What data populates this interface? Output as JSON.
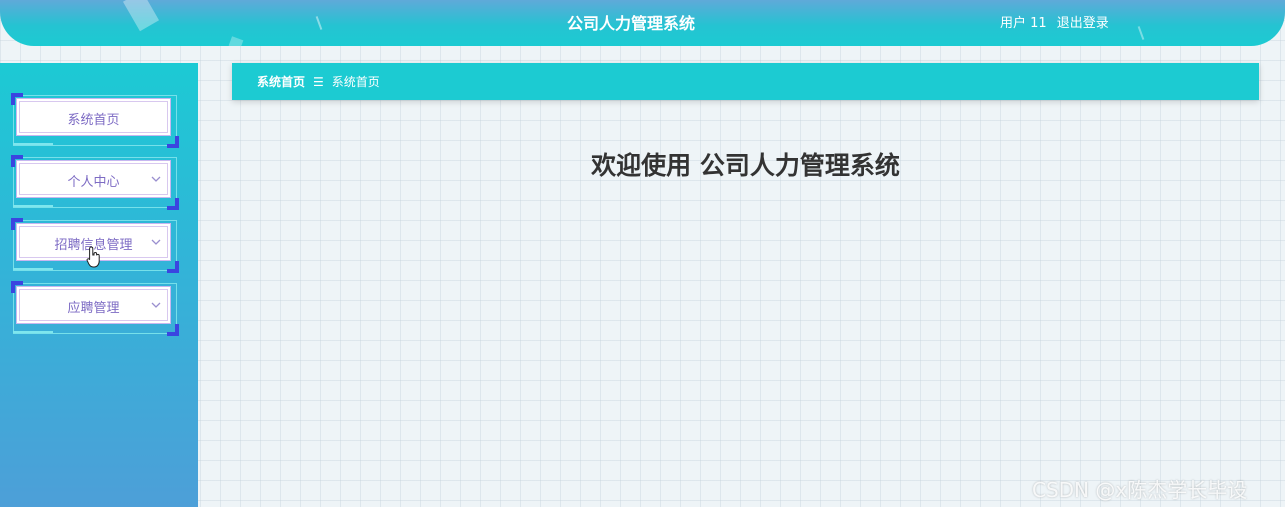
{
  "header": {
    "title": "公司人力管理系统",
    "user_label": "用户 11",
    "logout_label": "退出登录"
  },
  "sidebar": {
    "items": [
      {
        "label": "系统首页",
        "has_submenu": false
      },
      {
        "label": "个人中心",
        "has_submenu": true
      },
      {
        "label": "招聘信息管理",
        "has_submenu": true
      },
      {
        "label": "应聘管理",
        "has_submenu": true
      }
    ]
  },
  "breadcrumb": {
    "home": "系统首页",
    "separator": "☰",
    "current": "系统首页"
  },
  "main": {
    "welcome": "欢迎使用 公司人力管理系统"
  },
  "watermark": "CSDN @x陈杰学长毕设",
  "icons": {
    "chevron": "chevron-down-icon",
    "cursor": "hand-pointer-icon"
  },
  "colors": {
    "accent": "#1ccbd2",
    "menu_text": "#7d6bc4",
    "corner": "#3a45e0"
  }
}
